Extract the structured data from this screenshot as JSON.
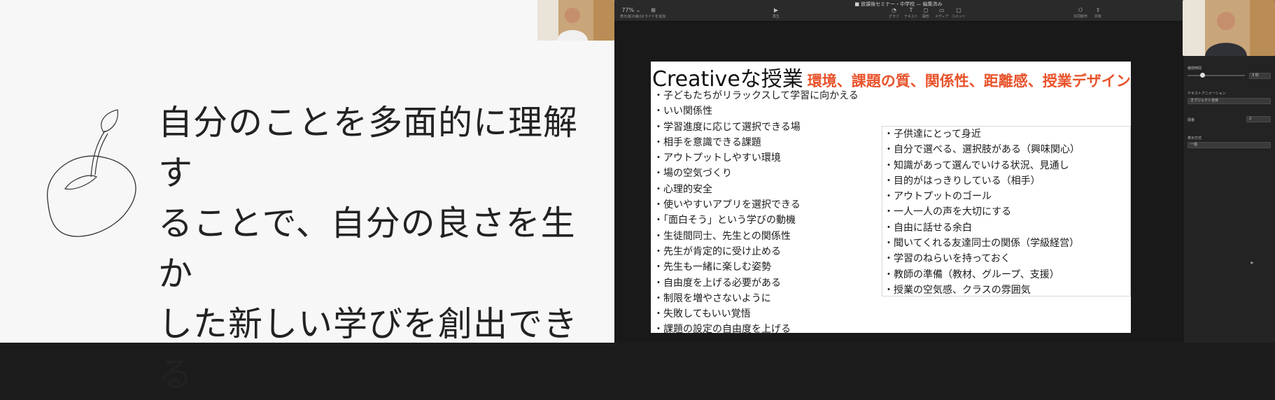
{
  "left_slide": {
    "quote_lines": [
      "自分のことを多面的に理解す",
      "ることで、自分の良さを生か",
      "した新しい学びを創出できる"
    ]
  },
  "keynote": {
    "document_title": "■ 放課後セミナー・中学校 — 編集済み",
    "toolbar": {
      "zoom": "77% ⌄",
      "zoom_label": "表示/拡大縮小",
      "add_slide_label": "スライドを追加",
      "play_label": "再生",
      "table_label": "グラフ",
      "text_label": "テキスト",
      "shape_label": "図形",
      "media_label": "メディア",
      "comment_label": "コメント",
      "collab_label": "共同制作",
      "share_label": "共有"
    },
    "slide": {
      "title_main": "Creativeな授業",
      "title_sub": "環境、課題の質、関係性、距離感、授業デザイン",
      "left_items": [
        "子どもたちがリラックスして学習に向かえる",
        "いい関係性",
        "学習進度に応じて選択できる場",
        "相手を意識できる課題",
        "アウトプットしやすい環境",
        "場の空気づくり",
        "心理的安全",
        "使いやすいアプリを選択できる",
        "「面白そう」という学びの動機",
        "生徒間同士、先生との関係性",
        "先生が肯定的に受け止める",
        "先生も一緒に楽しむ姿勢",
        "自由度を上げる必要がある",
        "制限を増やさないように",
        "失敗してもいい覚悟",
        "課題の設定の自由度を上げる"
      ],
      "right_items": [
        "子供達にとって身近",
        "自分で選べる、選択肢がある（興味関心）",
        "知識があって選んでいける状況、見通し",
        "目的がはっきりしている（相手）",
        "アウトプットのゴール",
        "一人一人の声を大切にする",
        "自由に話せる余白",
        "聞いてくれる友達同士の関係（学級経営）",
        "学習のねらいを持っておく",
        "教師の準備（教材、グループ、支援）",
        "授業の空気感、クラスの雰囲気"
      ]
    },
    "inspector": {
      "duration_label": "継続時間",
      "duration_value": "3 秒",
      "duration_level": 0.25,
      "text_animation_label": "テキストアニメーション",
      "text_animation_value": "オブジェクト全体",
      "order_label": "順番",
      "order_value": "2",
      "delivery_label": "表示方式",
      "delivery_value": "一括"
    }
  }
}
